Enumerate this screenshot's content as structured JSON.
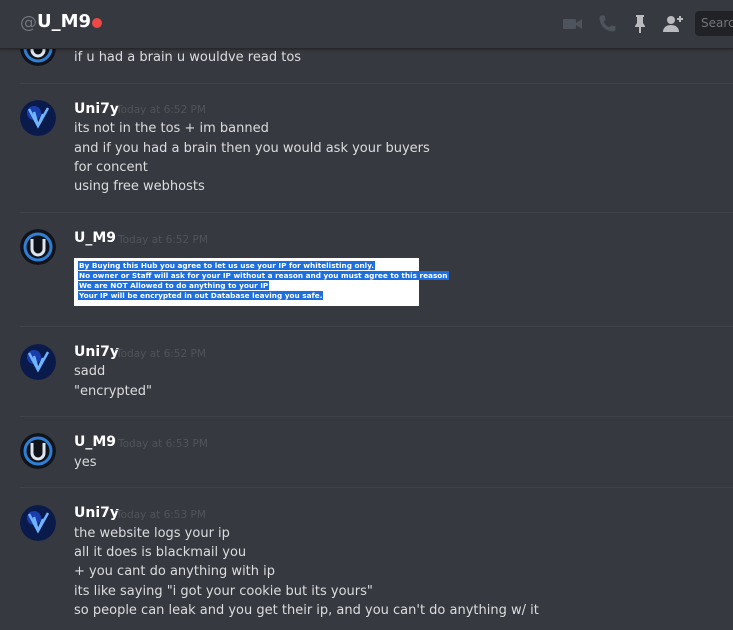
{
  "header": {
    "at": "@",
    "channel": "U_M9",
    "icons": [
      "video-icon",
      "phone-icon",
      "pin-icon",
      "add-member-icon"
    ],
    "search_placeholder": "Search"
  },
  "colors": {
    "background": "#36393f",
    "status_dnd": "#f04747",
    "highlight": "#1d6fe0"
  },
  "messages": [
    {
      "id": "m0",
      "author": "",
      "time": "",
      "lines": [
        "if u had a brain u wouldve read tos"
      ]
    },
    {
      "id": "m1",
      "author": "Uni7y",
      "time": "Today at 6:52 PM",
      "lines": [
        "its not in the tos + im banned",
        "and if you had a brain then you would ask your buyers",
        "for concent",
        "using free webhosts"
      ]
    },
    {
      "id": "m2",
      "author": "U_M9",
      "time": "Today at 6:52 PM",
      "attachment_lines": [
        "By Buying this Hub you agree to let us use your IP for whitelisting only.",
        "No owner or Staff will ask for your IP without a reason and you must agree to this reason",
        "We are NOT Allowed to do anything to your IP",
        "Your IP will be encrypted in out Database leaving you safe."
      ]
    },
    {
      "id": "m3",
      "author": "Uni7y",
      "time": "Today at 6:52 PM",
      "lines": [
        "sadd",
        "\"encrypted\""
      ]
    },
    {
      "id": "m4",
      "author": "U_M9",
      "time": "Today at 6:53 PM",
      "lines": [
        "yes"
      ]
    },
    {
      "id": "m5",
      "author": "Uni7y",
      "time": "Today at 6:53 PM",
      "lines": [
        "the website logs your ip",
        "all it does is blackmail you",
        "+ you cant do anything with ip",
        "its like saying \"i got your cookie but its yours\"",
        "so people can leak and you get their ip, and you can't do anything w/ it"
      ]
    }
  ]
}
